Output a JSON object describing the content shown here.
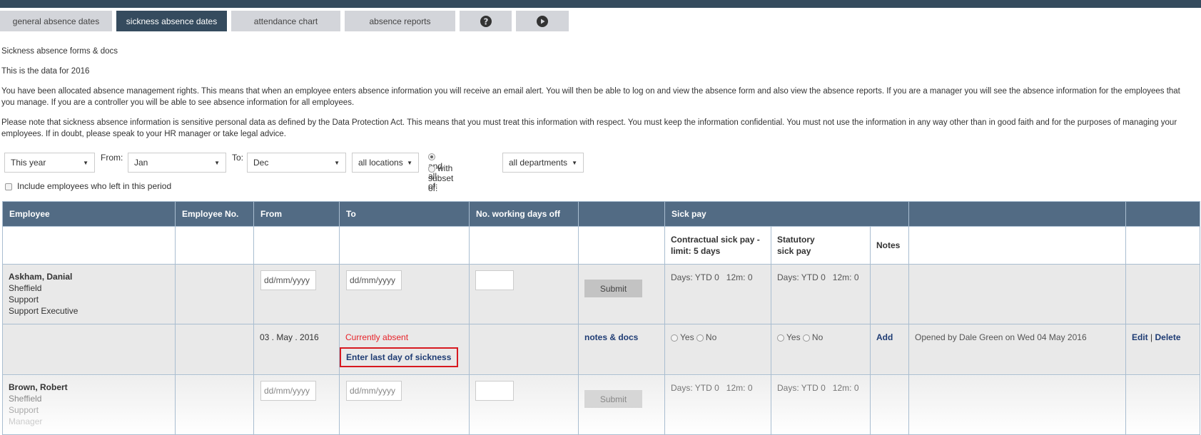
{
  "tabs": [
    {
      "label": "general absence dates",
      "active": false
    },
    {
      "label": "sickness absence dates",
      "active": true
    },
    {
      "label": "attendance chart",
      "active": false
    },
    {
      "label": "absence reports",
      "active": false
    },
    {
      "label": "",
      "icon": "help-icon"
    },
    {
      "label": "",
      "icon": "play-icon"
    }
  ],
  "page": {
    "heading": "Sickness absence forms & docs",
    "year_note": "This is the data for 2016",
    "para1": "You have been allocated absence management rights. This means that when an employee enters absence information you will receive an email alert. You will then be able to log on and view the absence form and also view the absence reports. If you are a manager you will see the absence information for the employees that you manage. If you are a controller you will be able to see absence information for all employees.",
    "para2": "Please note that sickness absence information is sensitive personal data as defined by the Data Protection Act. This means that you must treat this information with respect. You must keep the information confidential. You must not use the information in any way other than in good faith and for the purposes of managing your employees. If in doubt, please speak to your HR manager or take legal advice."
  },
  "filters": {
    "period": "This year",
    "from_label": "From:",
    "from": "Jan",
    "to_label": "To:",
    "to": "Dec",
    "location": "all locations",
    "radio_all": "and all of:",
    "radio_subset": "with subset of:",
    "radio_selected": "and all of:",
    "department": "all departments",
    "include_left_label": "Include employees who left in this period",
    "include_left_checked": false
  },
  "table": {
    "headers": [
      "Employee",
      "Employee No.",
      "From",
      "To",
      "No. working days off",
      "",
      "Sick pay",
      "",
      ""
    ],
    "subheaders": {
      "contractual": "Contractual sick pay - limit: 5 days",
      "statutory": "Statutory sick pay",
      "notes": "Notes"
    },
    "date_placeholder": "dd/mm/yyyy",
    "submit_label": "Submit",
    "employees": [
      {
        "name": "Askham, Danial",
        "location": "Sheffield",
        "department": "Support",
        "role": "Support Executive",
        "contractual_days": "Days: YTD 0   12m: 0",
        "statutory_days": "Days: YTD 0   12m: 0",
        "absence": {
          "from": "03 . May . 2016",
          "status": "Currently absent",
          "action_link": "Enter last day of sickness",
          "notes_docs_link": "notes & docs",
          "yes_label": "Yes",
          "no_label": "No",
          "notes_add": "Add",
          "opened_by": "Opened by Dale Green on Wed 04 May 2016",
          "edit": "Edit",
          "separator": "|",
          "delete": "Delete"
        }
      },
      {
        "name": "Brown, Robert",
        "location": "Sheffield",
        "department": "Support",
        "role": "Manager",
        "contractual_days": "Days: YTD 0   12m: 0",
        "statutory_days": "Days: YTD 0   12m: 0"
      }
    ]
  }
}
